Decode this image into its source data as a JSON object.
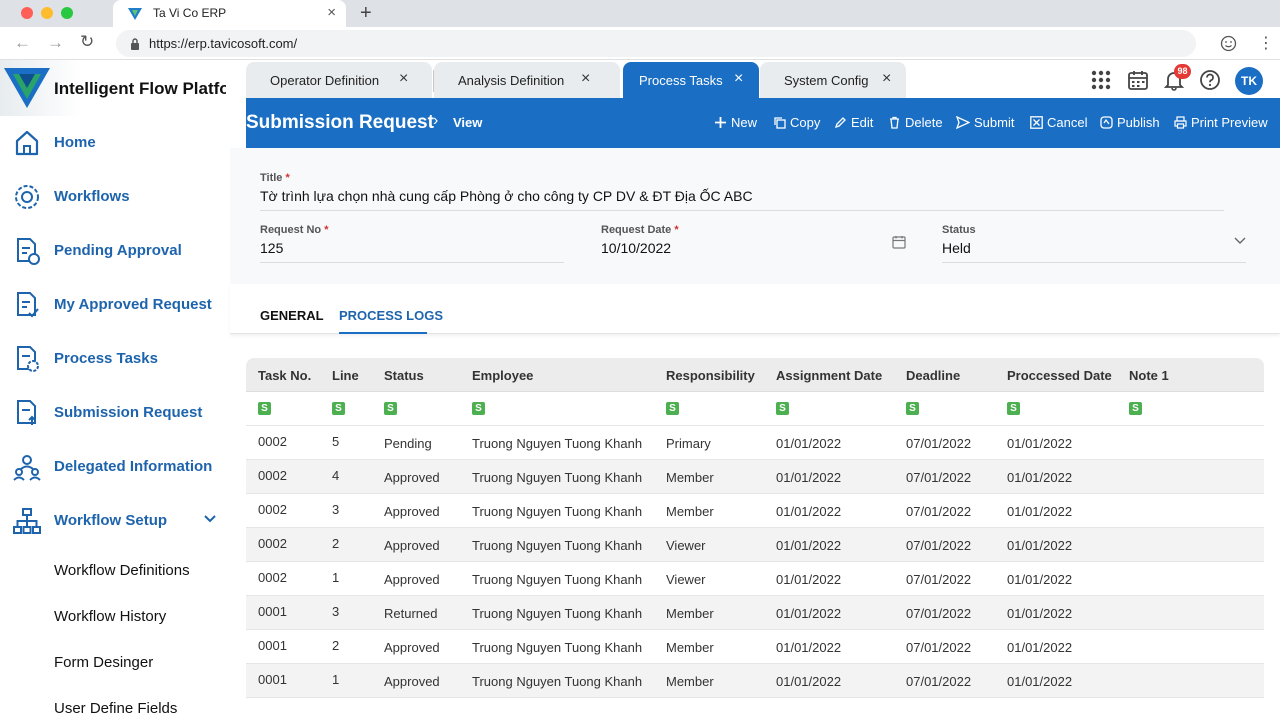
{
  "browser": {
    "tab_title": "Ta Vi Co ERP",
    "url": "https://erp.tavicosoft.com/"
  },
  "brand": {
    "name": "Intelligent Flow Platform"
  },
  "sidebar": {
    "items": [
      {
        "label": "Home",
        "icon": "home-icon"
      },
      {
        "label": "Workflows",
        "icon": "workflow-gear-icon"
      },
      {
        "label": "Pending Approval",
        "icon": "pending-doc-icon"
      },
      {
        "label": "My Approved Request",
        "icon": "approved-doc-icon"
      },
      {
        "label": "Process Tasks",
        "icon": "process-doc-icon"
      },
      {
        "label": "Submission Request",
        "icon": "submit-doc-icon"
      },
      {
        "label": "Delegated Information",
        "icon": "delegate-users-icon"
      },
      {
        "label": "Workflow Setup",
        "icon": "hierarchy-icon"
      }
    ],
    "subitems": [
      "Workflow Definitions",
      "Workflow History",
      "Form Desinger",
      "User Define Fields"
    ]
  },
  "app_tabs": [
    {
      "label": "Operator Definition"
    },
    {
      "label": "Analysis Definition"
    },
    {
      "label": "Process Tasks"
    },
    {
      "label": "System Config"
    }
  ],
  "topbar": {
    "notification_count": "98",
    "avatar_initials": "TK"
  },
  "header": {
    "title": "Submission Request",
    "crumb": "View",
    "actions": [
      "New",
      "Copy",
      "Edit",
      "Delete",
      "Submit",
      "Cancel",
      "Publish",
      "Print Preview"
    ]
  },
  "form": {
    "title_label": "Title",
    "title_value": "Tờ trình lựa chọn nhà cung cấp Phòng ở cho công ty CP DV & ĐT Địa ỐC ABC",
    "request_no_label": "Request No",
    "request_no_value": "125",
    "request_date_label": "Request Date",
    "request_date_value": "10/10/2022",
    "status_label": "Status",
    "status_value": "Held",
    "required_mark": "*"
  },
  "section_tabs": {
    "general": "GENERAL",
    "process_logs": "PROCESS LOGS"
  },
  "table": {
    "columns": [
      "Task No.",
      "Line",
      "Status",
      "Employee",
      "Responsibility",
      "Assignment Date",
      "Deadline",
      "Proccessed Date",
      "Note 1"
    ],
    "filter_label": "S",
    "rows": [
      [
        "0002",
        "5",
        "Pending",
        "Truong Nguyen Tuong Khanh",
        "Primary",
        "01/01/2022",
        "07/01/2022",
        "01/01/2022",
        ""
      ],
      [
        "0002",
        "4",
        "Approved",
        "Truong Nguyen Tuong Khanh",
        "Member",
        "01/01/2022",
        "07/01/2022",
        "01/01/2022",
        ""
      ],
      [
        "0002",
        "3",
        "Approved",
        "Truong Nguyen Tuong Khanh",
        "Member",
        "01/01/2022",
        "07/01/2022",
        "01/01/2022",
        ""
      ],
      [
        "0002",
        "2",
        "Approved",
        "Truong Nguyen Tuong Khanh",
        "Viewer",
        "01/01/2022",
        "07/01/2022",
        "01/01/2022",
        ""
      ],
      [
        "0002",
        "1",
        "Approved",
        "Truong Nguyen Tuong Khanh",
        "Viewer",
        "01/01/2022",
        "07/01/2022",
        "01/01/2022",
        ""
      ],
      [
        "0001",
        "3",
        "Returned",
        "Truong Nguyen Tuong Khanh",
        "Member",
        "01/01/2022",
        "07/01/2022",
        "01/01/2022",
        ""
      ],
      [
        "0001",
        "2",
        "Approved",
        "Truong Nguyen Tuong Khanh",
        "Member",
        "01/01/2022",
        "07/01/2022",
        "01/01/2022",
        ""
      ],
      [
        "0001",
        "1",
        "Approved",
        "Truong Nguyen Tuong Khanh",
        "Member",
        "01/01/2022",
        "07/01/2022",
        "01/01/2022",
        ""
      ]
    ]
  },
  "colors": {
    "primary": "#1a6fc4",
    "nav_text": "#1e64ad",
    "filter_green": "#4caf50",
    "badge_red": "#e53935"
  }
}
